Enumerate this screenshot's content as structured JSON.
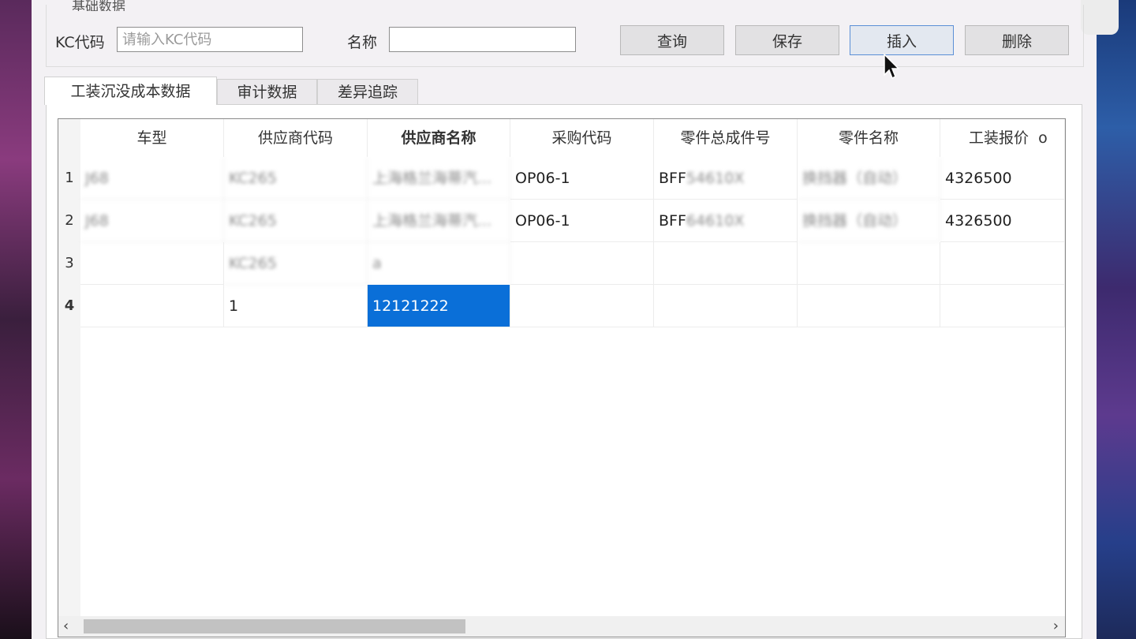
{
  "group": {
    "title": "基础数据"
  },
  "search": {
    "kc_label": "KC代码",
    "kc_placeholder": "请输入KC代码",
    "kc_value": "",
    "name_label": "名称",
    "name_value": ""
  },
  "buttons": {
    "query": "查询",
    "save": "保存",
    "insert": "插入",
    "delete": "删除"
  },
  "tabs": [
    "工装沉没成本数据",
    "审计数据",
    "差异追踪"
  ],
  "grid": {
    "columns": [
      "车型",
      "供应商代码",
      "供应商名称",
      "采购代码",
      "零件总成件号",
      "零件名称",
      "工装报价"
    ],
    "header_overflow_glyph": "o",
    "rows": [
      {
        "num": "1",
        "cells": [
          "J68",
          "KC265",
          "上海格兰海蒂汽...",
          "OP06-1",
          "BFF54610X",
          "换挡器（自动）",
          "4326500"
        ]
      },
      {
        "num": "2",
        "cells": [
          "J68",
          "KC265",
          "上海格兰海蒂汽...",
          "OP06-1",
          "BFF64610X",
          "换挡器（自动）",
          "4326500"
        ]
      },
      {
        "num": "3",
        "cells": [
          "",
          "KC265",
          "a",
          "",
          "",
          "",
          ""
        ]
      },
      {
        "num": "4",
        "cells": [
          "",
          "1",
          "12121222",
          "",
          "",
          "",
          ""
        ]
      }
    ],
    "part_no_visible_prefix": "BFF"
  },
  "colors": {
    "selection": "#0a6fd8",
    "accent_focus": "#5b8fd6"
  },
  "icons": {
    "scroll_left": "‹",
    "scroll_right": "›"
  }
}
